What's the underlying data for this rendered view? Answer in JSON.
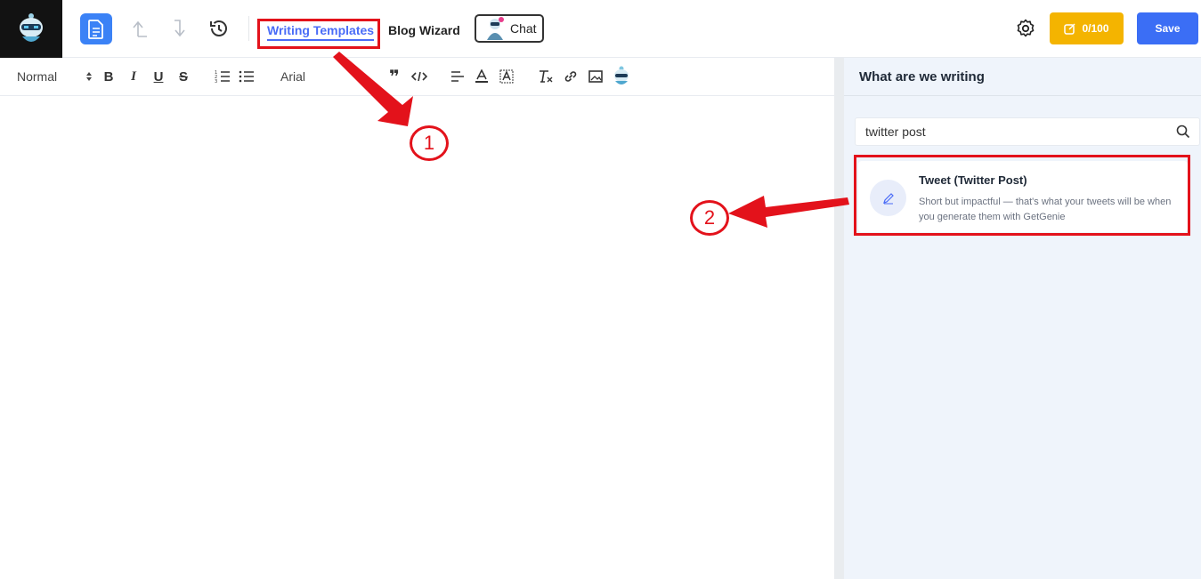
{
  "header": {
    "tabs": [
      {
        "label": "Writing Templates",
        "active": true
      },
      {
        "label": "Blog Wizard",
        "active": false
      }
    ],
    "chat_label": "Chat",
    "credits_label": "0/100",
    "save_label": "Save"
  },
  "toolbar": {
    "format_select": "Normal",
    "font_select": "Arial",
    "tools": [
      "bold-icon",
      "italic-icon",
      "underline-icon",
      "strike-icon",
      "ordered-list-icon",
      "bullet-list-icon",
      "quote-icon",
      "code-icon",
      "align-icon",
      "text-color-icon",
      "highlight-icon",
      "clear-format-icon",
      "link-icon",
      "image-icon",
      "genie-icon"
    ]
  },
  "panel": {
    "title": "What are we writing",
    "search_value": "twitter post",
    "results": [
      {
        "title": "Tweet (Twitter Post)",
        "description": "Short but impactful — that's what your tweets will be when you generate them with GetGenie"
      }
    ]
  },
  "annotations": {
    "step1": "1",
    "step2": "2",
    "color": "#e3121b"
  },
  "colors": {
    "accent": "#4a6cf7",
    "save": "#3b6ef5",
    "credits": "#f4b400",
    "panel_bg": "#eff4fb"
  }
}
